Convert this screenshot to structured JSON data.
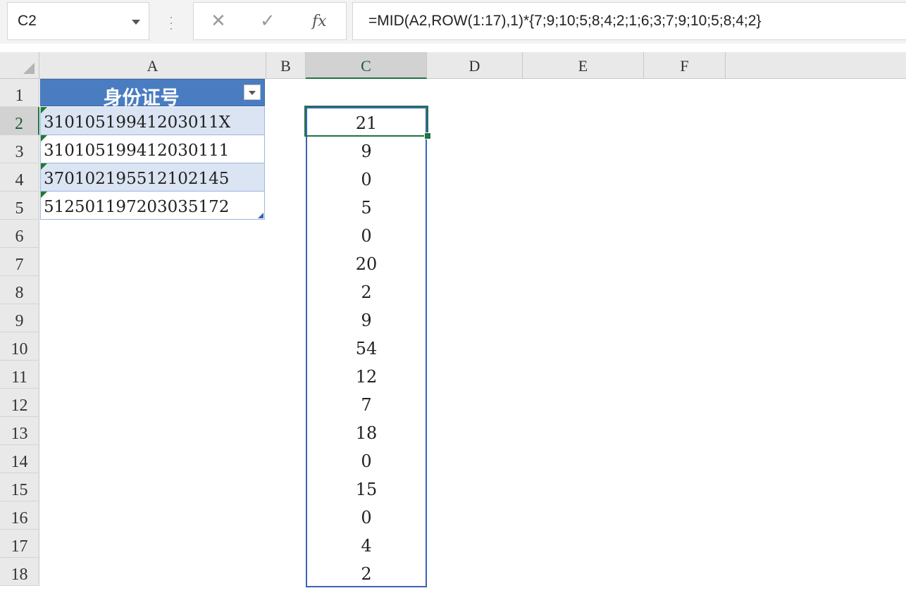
{
  "formula_bar": {
    "name_box": "C2",
    "cancel_icon": "✕",
    "enter_icon": "✓",
    "fx_label": "fx",
    "formula": "=MID(A2,ROW(1:17),1)*{7;9;10;5;8;4;2;1;6;3;7;9;10;5;8;4;2}"
  },
  "columns": [
    "A",
    "B",
    "C",
    "D",
    "E",
    "F"
  ],
  "rows": [
    "1",
    "2",
    "3",
    "4",
    "5",
    "6",
    "7",
    "8",
    "9",
    "10",
    "11",
    "12",
    "13",
    "14",
    "15",
    "16",
    "17",
    "18"
  ],
  "table": {
    "header": "身份证号",
    "values": [
      "31010519941203011X",
      "310105199412030111",
      "370102195512102145",
      "512501197203035172"
    ]
  },
  "column_c": [
    "21",
    "9",
    "0",
    "5",
    "0",
    "20",
    "2",
    "9",
    "54",
    "12",
    "7",
    "18",
    "0",
    "15",
    "0",
    "4",
    "2"
  ],
  "colors": {
    "table_header": "#4a7cc2",
    "band": "#dbe4f2",
    "selection": "#217346",
    "spill_border": "#3a63b8"
  }
}
